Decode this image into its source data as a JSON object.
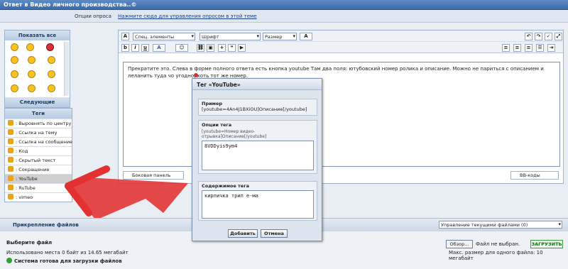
{
  "window": {
    "title": "Ответ в Видео личного производства..©"
  },
  "options": {
    "label": "Опции опроса",
    "link": "Нажмите сюда для управления опросом в этой теме"
  },
  "sidebar": {
    "smilies_title": "Показать все",
    "smilies_next": "Следующие",
    "tags_title": "Теги",
    "tags": [
      ": Выровнять по центру",
      ": Ссылка на тему",
      ": Ссылка на сообщение",
      ": Код",
      ": Скрытый текст",
      ": Сокращение",
      ": YouTube",
      ": RuTube",
      ": vimeo"
    ]
  },
  "editor": {
    "toolbar": {
      "special": "Спец. элементы",
      "font": "Шрифт",
      "size": "Размер",
      "bold": "b",
      "italic": "i",
      "underline": "u",
      "color": "A"
    },
    "text": "Прекратите это. Слева в форме полного ответа есть кнопка youtube Там два поля: ютубовский номер ролика и описание. Можно не париться с описанием и леланить туда чо угодно, хоть тот же номер.",
    "side_panel": "Боковая панель",
    "bb_codes": "ВВ-коды"
  },
  "modal": {
    "title": "Тег «YouTube»",
    "example_label": "Пример",
    "example": "[youtube=4An4J1BXiOU]Описание[/youtube]",
    "options_label": "Опции тега",
    "options_hint": "[youtube=Номер видео-отрывка]Описание[/youtube]",
    "option_value": "8VDDyis9ym4",
    "content_label": "Содержимое тега",
    "content_value": "кирпичка трип е-ма",
    "add": "Добавить",
    "cancel": "Отмена"
  },
  "attachments": {
    "title": "Прикрепление файлов",
    "manage": "Управление текущими файлами (0)",
    "choose": "Выберите файл",
    "usage": "Использовано места 0 байт из 14.65 мегабайт",
    "browse": "Обзор...",
    "no_file": "Файл не выбран.",
    "upload": "ЗАГРУЗИТЬ",
    "max_size": "Макс. размер для одного файла: 10 мегабайт",
    "ready": "Система готова для загрузки файлов"
  }
}
